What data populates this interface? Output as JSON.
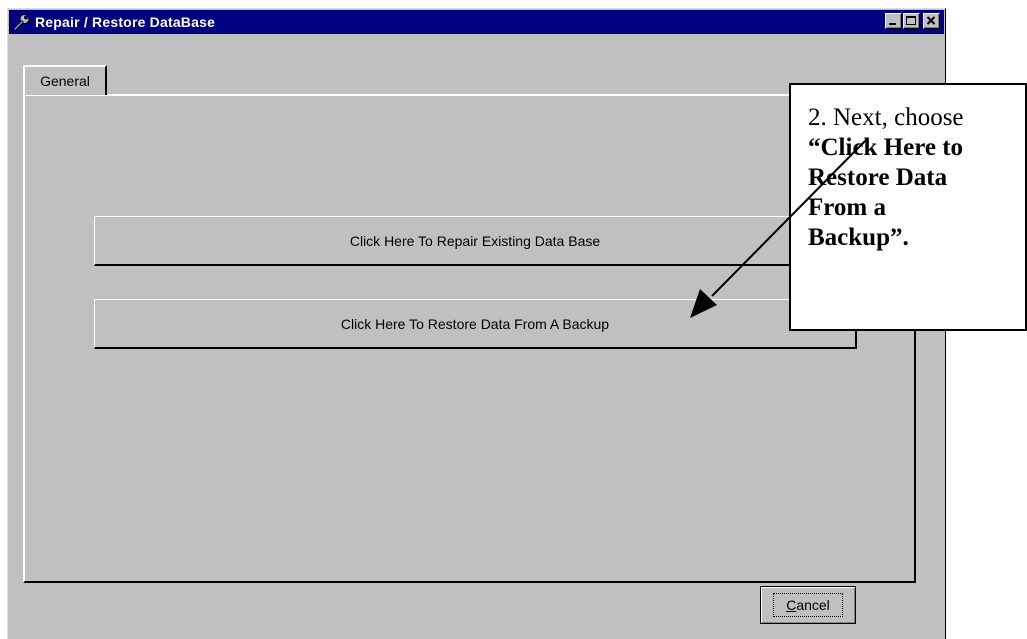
{
  "window": {
    "title": "Repair / Restore DataBase",
    "titlebar_color": "#000080",
    "face_color": "#c0c0c0"
  },
  "tabs": [
    {
      "label": "General",
      "selected": true
    }
  ],
  "buttons": {
    "repair_label": "Click Here To Repair Existing Data Base",
    "restore_label": "Click Here To Restore Data From A Backup",
    "cancel_label_rest": "ancel",
    "cancel_mnemonic": "C"
  },
  "callout": {
    "line1": "2. Next, choose",
    "line2": "“Click Here to",
    "line3": "Restore Data",
    "line4": "From a",
    "line5": "Backup”."
  },
  "icons": {
    "title_icon": "wrench-icon",
    "minimize": "minimize-icon",
    "maximize": "maximize-icon",
    "close": "close-icon"
  }
}
